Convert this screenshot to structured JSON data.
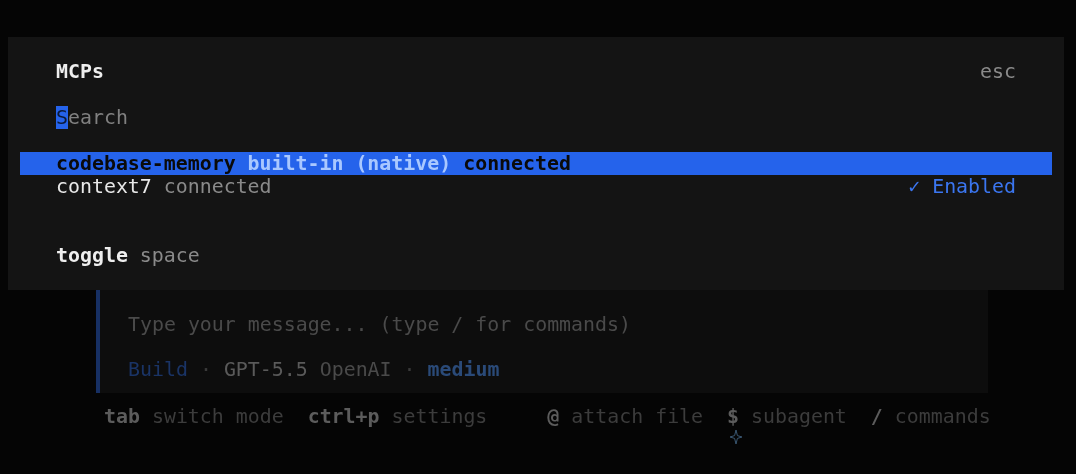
{
  "dialog": {
    "title": "MCPs",
    "close_hint": "esc",
    "search": {
      "placeholder": "Search"
    },
    "enabled_label": "✓ Enabled",
    "items": [
      {
        "name": "codebase-memory",
        "source": "built-in (native)",
        "status": "connected",
        "selected": true,
        "enabled": false
      },
      {
        "name": "context7",
        "status": "connected",
        "selected": false,
        "enabled": true
      }
    ],
    "footer": {
      "key": "toggle",
      "action": "space"
    }
  },
  "input": {
    "placeholder": "Type your message... (type / for commands)",
    "mode": "Build",
    "separator_1": "·",
    "model": "GPT-5.5",
    "provider": "OpenAI",
    "separator_2": "·",
    "effort": "medium"
  },
  "shortcuts_left": [
    {
      "key": "tab",
      "action": "switch mode"
    },
    {
      "key": "ctrl+p",
      "action": "settings"
    }
  ],
  "shortcuts_right": [
    {
      "key": "@",
      "action": "attach file"
    },
    {
      "key": "$",
      "action": "subagent"
    },
    {
      "key": "/",
      "action": "commands"
    }
  ]
}
